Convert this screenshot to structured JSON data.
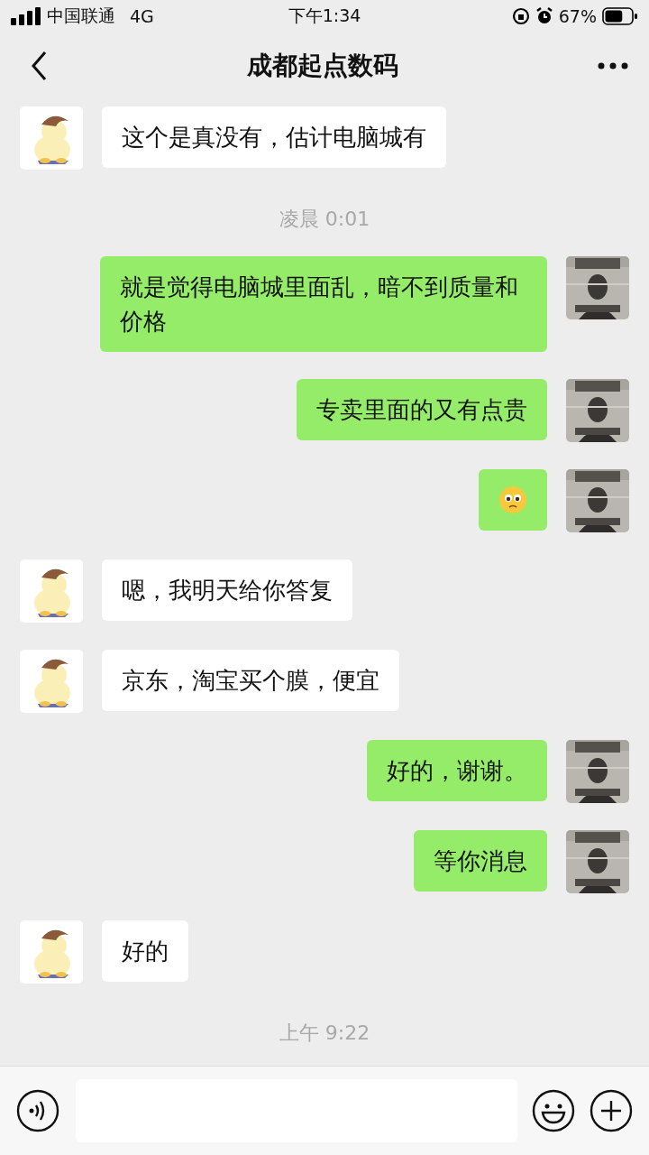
{
  "status_bar": {
    "carrier": "中国联通",
    "network": "4G",
    "time": "下午1:34",
    "battery": "67%"
  },
  "nav": {
    "title": "成都起点数码"
  },
  "messages": [
    {
      "kind": "text",
      "outgoing": false,
      "text": "这个是真没有，估计电脑城有"
    },
    {
      "kind": "timestamp",
      "text": "凌晨 0:01"
    },
    {
      "kind": "text",
      "outgoing": true,
      "text": "就是觉得电脑城里面乱，暗不到质量和价格"
    },
    {
      "kind": "text",
      "outgoing": true,
      "text": "专卖里面的又有点贵"
    },
    {
      "kind": "emoji",
      "outgoing": true
    },
    {
      "kind": "text",
      "outgoing": false,
      "text": "嗯，我明天给你答复"
    },
    {
      "kind": "text",
      "outgoing": false,
      "text": "京东，淘宝买个膜，便宜"
    },
    {
      "kind": "text",
      "outgoing": true,
      "text": "好的，谢谢。"
    },
    {
      "kind": "text",
      "outgoing": true,
      "text": "等你消息"
    },
    {
      "kind": "text",
      "outgoing": false,
      "text": "好的"
    },
    {
      "kind": "timestamp",
      "text": "上午 9:22"
    }
  ]
}
